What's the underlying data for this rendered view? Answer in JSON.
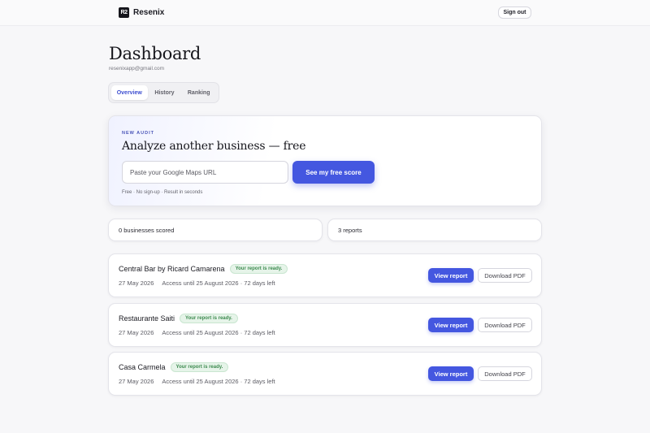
{
  "header": {
    "logo_text": "R2",
    "brand": "Resenix",
    "signout_label": "Sign out"
  },
  "dashboard": {
    "title": "Dashboard",
    "email": "resenixapp@gmail.com"
  },
  "tabs": [
    {
      "label": "Overview",
      "active": true
    },
    {
      "label": "History",
      "active": false
    },
    {
      "label": "Ranking",
      "active": false
    }
  ],
  "audit": {
    "eyebrow": "NEW AUDIT",
    "heading": "Analyze another business — free",
    "input_placeholder": "Paste your Google Maps URL",
    "input_value": "",
    "cta_label": "See my free score",
    "note": "Free · No sign-up · Result in seconds"
  },
  "stats": [
    {
      "label": "0 businesses scored"
    },
    {
      "label": "3 reports"
    }
  ],
  "reports": [
    {
      "name": "Central Bar by Ricard Camarena",
      "badge": "Your report is ready.",
      "date": "27 May 2026",
      "access": "Access until 25 August 2026 · 72 days left",
      "view_label": "View report",
      "pdf_label": "Download PDF"
    },
    {
      "name": "Restaurante Saiti",
      "badge": "Your report is ready.",
      "date": "27 May 2026",
      "access": "Access until 25 August 2026 · 72 days left",
      "view_label": "View report",
      "pdf_label": "Download PDF"
    },
    {
      "name": "Casa Carmela",
      "badge": "Your report is ready.",
      "date": "27 May 2026",
      "access": "Access until 25 August 2026 · 72 days left",
      "view_label": "View report",
      "pdf_label": "Download PDF"
    }
  ],
  "colors": {
    "accent": "#4457e0",
    "success_text": "#3d8a4f",
    "success_bg": "#e6f4e9",
    "background": "#f7f7f9"
  }
}
